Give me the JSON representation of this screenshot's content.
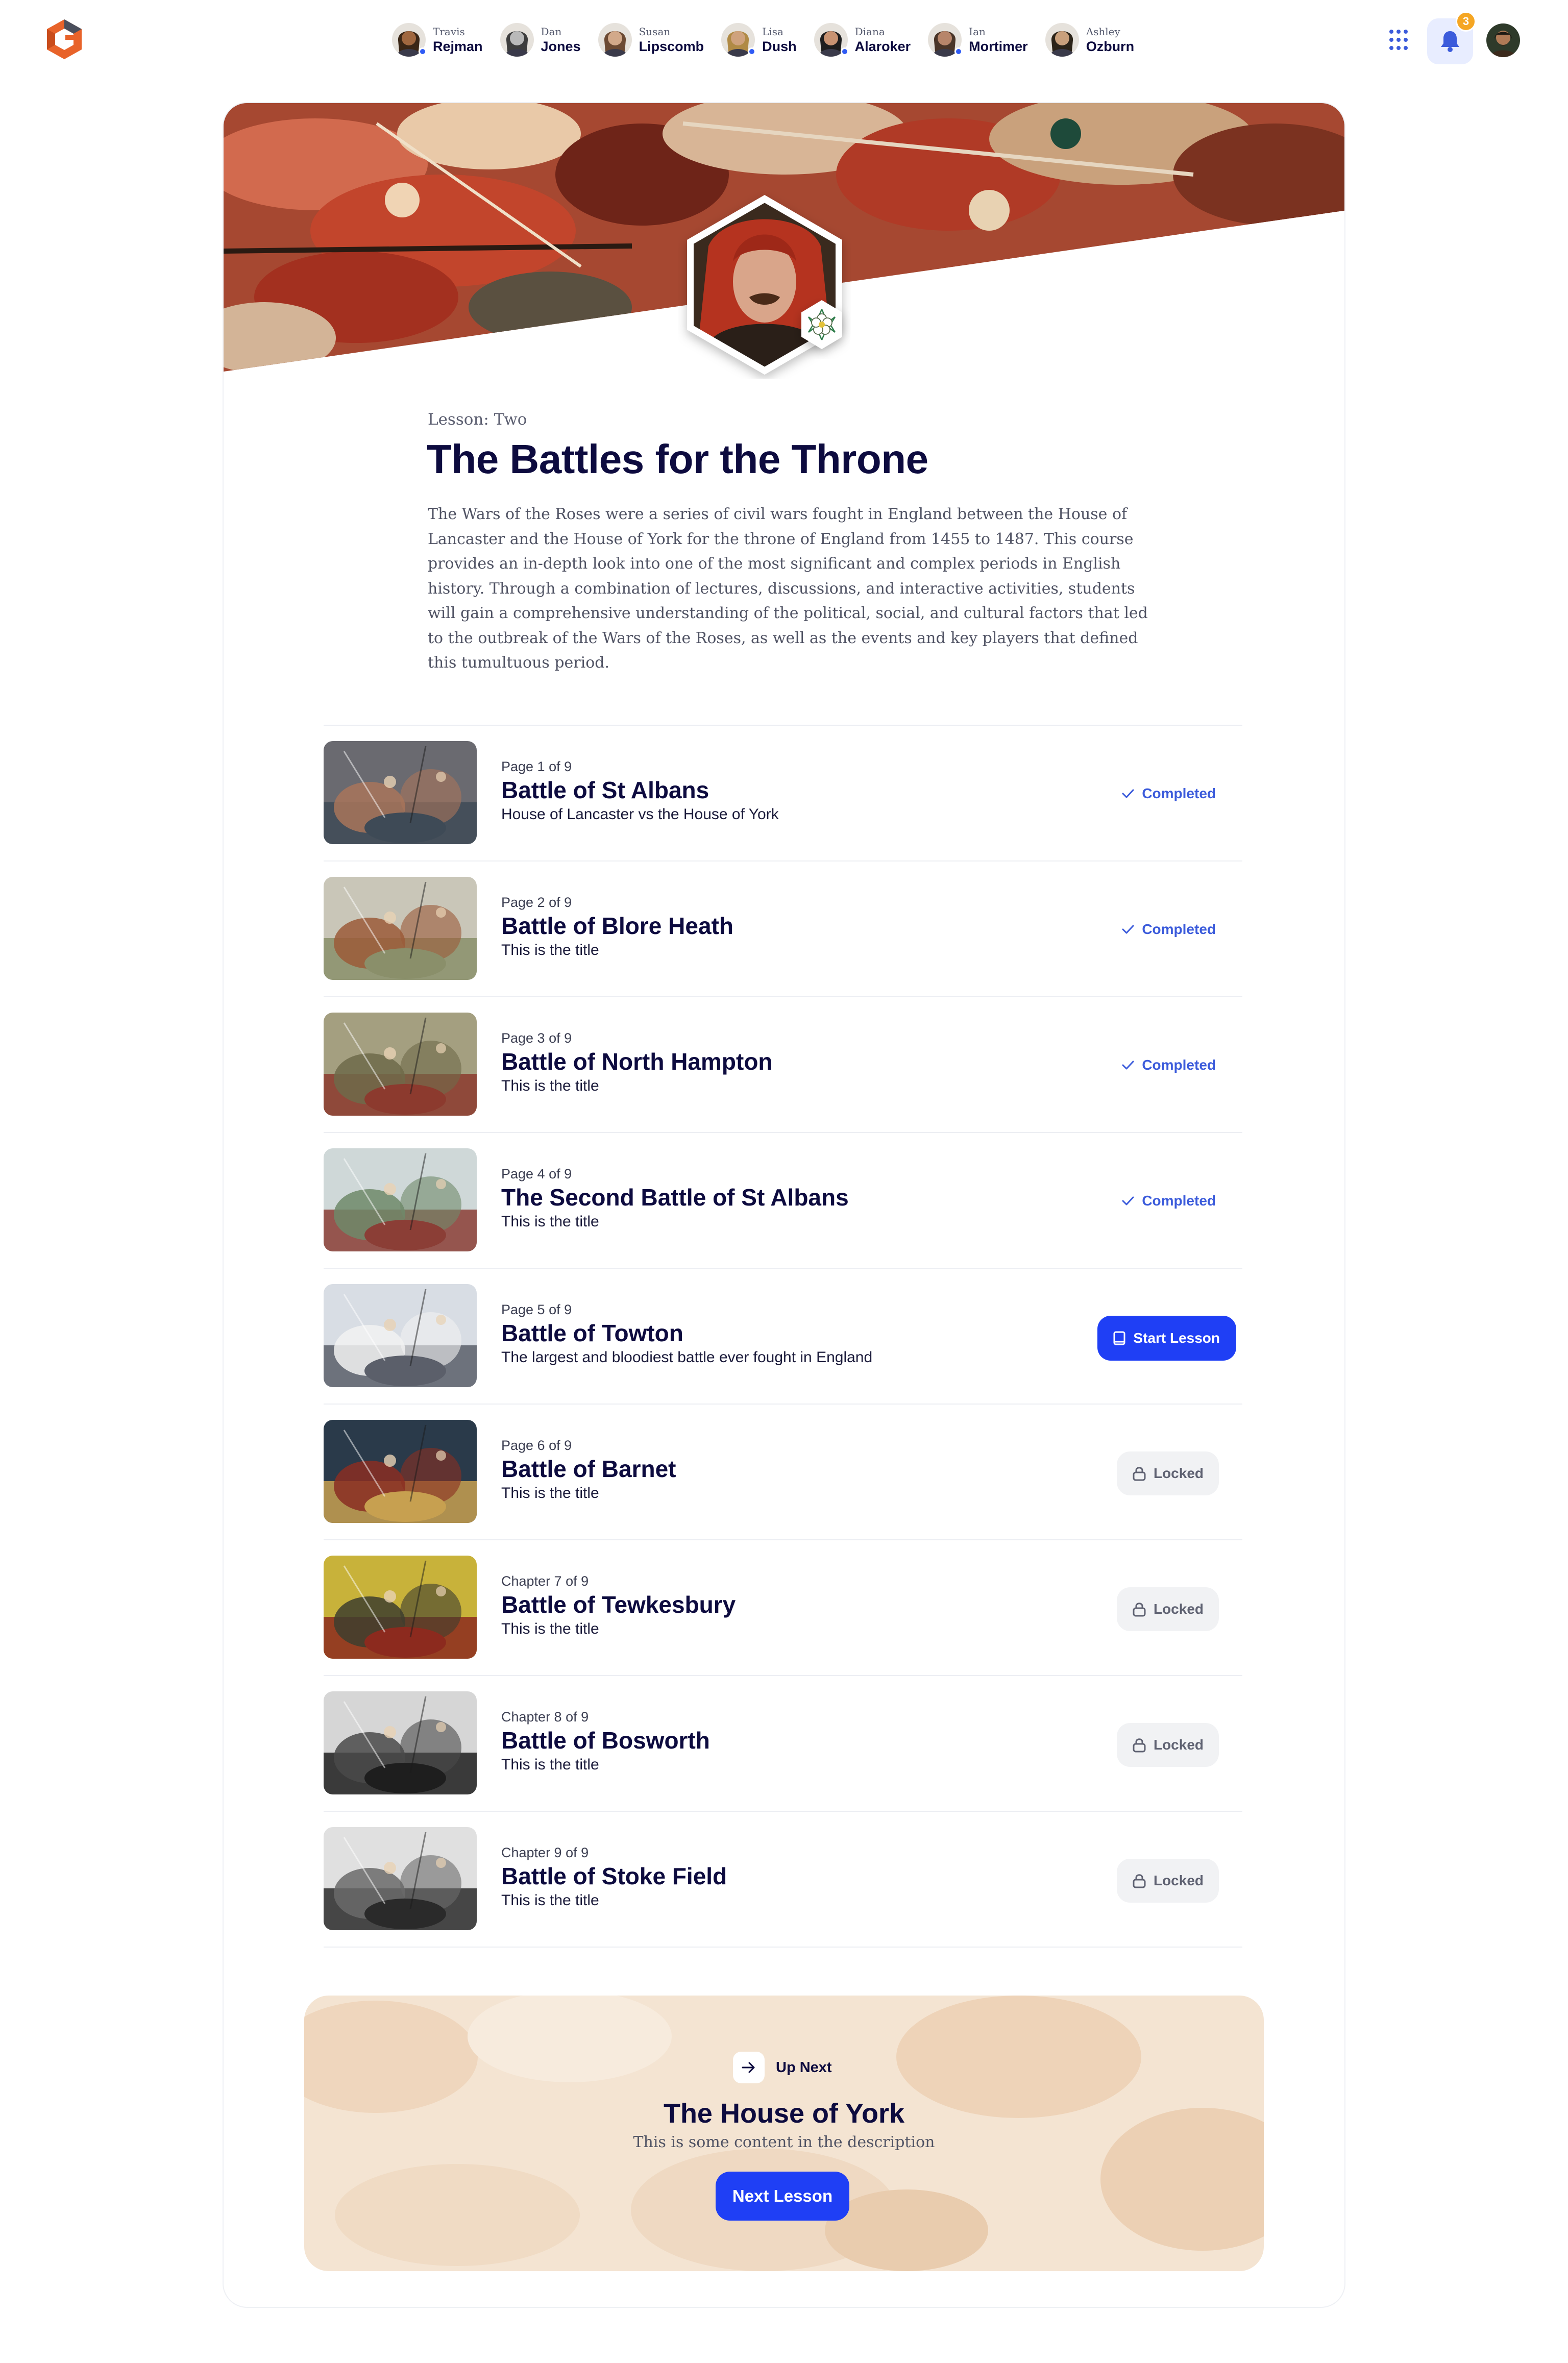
{
  "people": [
    {
      "first": "Travis",
      "last": "Rejman",
      "online": true,
      "skin": "#a0673f",
      "hair": "#3a2616"
    },
    {
      "first": "Dan",
      "last": "Jones",
      "online": false,
      "skin": "#b9b9b9",
      "hair": "#3d3d3d"
    },
    {
      "first": "Susan",
      "last": "Lipscomb",
      "online": false,
      "skin": "#d2a98a",
      "hair": "#6c4a33"
    },
    {
      "first": "Lisa",
      "last": "Dush",
      "online": true,
      "skin": "#cfa27d",
      "hair": "#b08a45"
    },
    {
      "first": "Diana",
      "last": "Alaroker",
      "online": true,
      "skin": "#c89372",
      "hair": "#1e1e1e"
    },
    {
      "first": "Ian",
      "last": "Mortimer",
      "online": true,
      "skin": "#b7856a",
      "hair": "#4a3528"
    },
    {
      "first": "Ashley",
      "last": "Ozburn",
      "online": false,
      "skin": "#c9a07c",
      "hair": "#2c2419"
    }
  ],
  "nav": {
    "apps_icon": "grid-dots-icon",
    "notifications_icon": "bell-icon",
    "notification_count": "3"
  },
  "lesson": {
    "label": "Lesson: Two",
    "title": "The Battles for the Throne",
    "description": "The Wars of the Roses were a series of civil wars fought in England between the House of Lancaster and the House of York for the throne of England from 1455 to 1487. This course provides an in-depth look into one of the most significant and complex periods in English history. Through a combination of lectures, discussions, and interactive activities, students will gain a comprehensive understanding of the political, social, and cultural factors that led to the outbreak of the Wars of the Roses, as well as the events and key players that defined this tumultuous period."
  },
  "pages": [
    {
      "page": "Page 1 of 9",
      "title": "Battle of St Albans",
      "subtitle": "House of Lancaster vs the House of York",
      "status": "completed",
      "status_label": "Completed",
      "thumb_colors": [
        "#6a6a70",
        "#a8745a",
        "#3e4a56"
      ]
    },
    {
      "page": "Page 2 of 9",
      "title": "Battle of Blore Heath",
      "subtitle": "This is the title",
      "status": "completed",
      "status_label": "Completed",
      "thumb_colors": [
        "#c9c6b8",
        "#9b5a38",
        "#8a8f6a"
      ]
    },
    {
      "page": "Page 3 of 9",
      "title": "Battle of North Hampton",
      "subtitle": "This is the title",
      "status": "completed",
      "status_label": "Completed",
      "thumb_colors": [
        "#a49f80",
        "#6f6a4a",
        "#8c3a2e"
      ]
    },
    {
      "page": "Page 4 of 9",
      "title": "The Second Battle of St Albans",
      "subtitle": "This is the title",
      "status": "completed",
      "status_label": "Completed",
      "thumb_colors": [
        "#cfd8d8",
        "#6f8a6a",
        "#8b3e36"
      ]
    },
    {
      "page": "Page 5 of 9",
      "title": "Battle of Towton",
      "subtitle": "The largest and bloodiest battle ever fought in England",
      "status": "start",
      "status_label": "Start Lesson",
      "thumb_colors": [
        "#d8dde4",
        "#f2f2f2",
        "#5b5f6a"
      ]
    },
    {
      "page": "Page 6 of 9",
      "title": "Battle of Barnet",
      "subtitle": "This is the title",
      "status": "locked",
      "status_label": "Locked",
      "thumb_colors": [
        "#2a3a4a",
        "#8a2e22",
        "#c7a050"
      ]
    },
    {
      "page": "Chapter 7 of 9",
      "title": "Battle of Tewkesbury",
      "subtitle": "This is the title",
      "status": "locked",
      "status_label": "Locked",
      "thumb_colors": [
        "#c8b23a",
        "#3e3e2e",
        "#8c2a1e"
      ]
    },
    {
      "page": "Chapter 8 of 9",
      "title": "Battle of Bosworth",
      "subtitle": "This is the title",
      "status": "locked",
      "status_label": "Locked",
      "thumb_colors": [
        "#d6d6d6",
        "#4a4a4a",
        "#1e1e1e"
      ]
    },
    {
      "page": "Chapter 9 of 9",
      "title": "Battle of Stoke Field",
      "subtitle": "This is the title",
      "status": "locked",
      "status_label": "Locked",
      "thumb_colors": [
        "#e0e0e0",
        "#6a6a6a",
        "#2a2a2a"
      ]
    }
  ],
  "up_next": {
    "label": "Up Next",
    "title": "The House of York",
    "description": "This is some content in the description",
    "button": "Next Lesson"
  },
  "colors": {
    "accent": "#1f3ff5",
    "navy": "#0d0b3f",
    "badge": "#f5a623",
    "completed": "#3b5bdb"
  }
}
